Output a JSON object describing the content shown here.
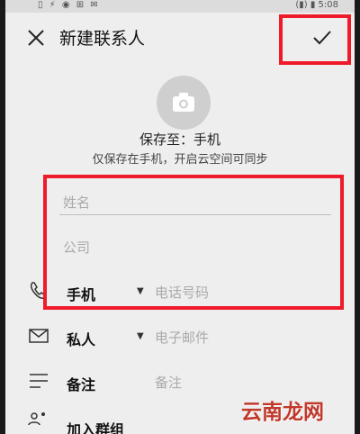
{
  "status": {
    "left": "▯ ⚡ ◉ ⊞ ✉",
    "right": "(▮) ▮ 5:08"
  },
  "header": {
    "title": "新建联系人"
  },
  "save": {
    "location": "保存至：手机",
    "note": "仅保存在手机，开启云空间可同步"
  },
  "form": {
    "name_placeholder": "姓名",
    "company_placeholder": "公司",
    "phone": {
      "label": "手机",
      "placeholder": "电话号码"
    },
    "email": {
      "label": "私人",
      "placeholder": "电子邮件"
    },
    "notes": {
      "label": "备注",
      "placeholder": "备注"
    },
    "group": {
      "label": "加入群组"
    }
  },
  "watermark": "云南龙网",
  "colors": {
    "highlight": "#ef1b2a",
    "background": "#eeeeee"
  }
}
